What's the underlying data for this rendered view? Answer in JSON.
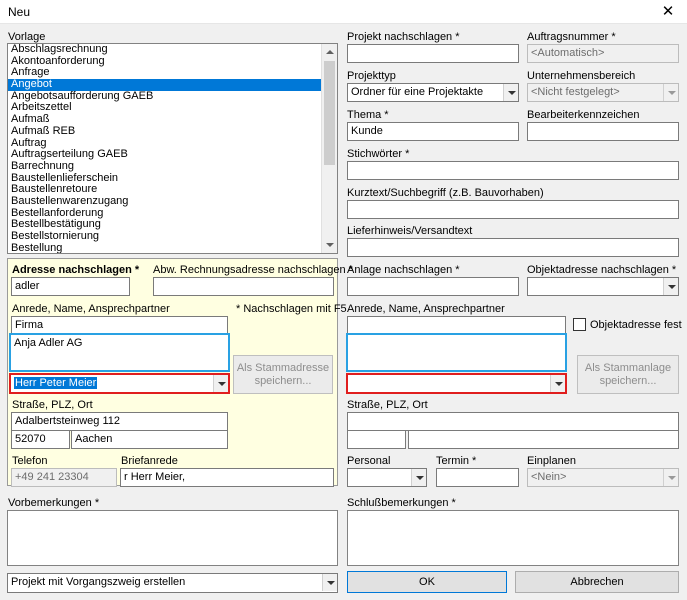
{
  "window": {
    "title": "Neu",
    "close": "✕"
  },
  "vorlage": {
    "label": "Vorlage",
    "selected_index": 3,
    "items": [
      "Abschlagsrechnung",
      "Akontoanforderung",
      "Anfrage",
      "Angebot",
      "Angebotsaufforderung GAEB",
      "Arbeitszettel",
      "Aufmaß",
      "Aufmaß REB",
      "Auftrag",
      "Auftragserteilung GAEB",
      "Barrechnung",
      "Baustellenlieferschein",
      "Baustellenretoure",
      "Baustellenwarenzugang",
      "Bestellanforderung",
      "Bestellbestätigung",
      "Bestellstornierung",
      "Bestellung"
    ]
  },
  "adresse": {
    "nachschlagen_label": "Adresse nachschlagen *",
    "nachschlagen_value": "adler",
    "abw_label": "Abw. Rechnungsadresse nachschlagen *",
    "abw_value": "",
    "anrede_label": "Anrede, Name, Ansprechpartner",
    "f5_hint": "* Nachschlagen mit F5",
    "anrede_value": "Firma",
    "name_value": "Anja Adler AG",
    "ansprechpartner": "Herr Peter Meier",
    "stamm_button": "Als Stammadresse speichern...",
    "strasse_label": "Straße, PLZ, Ort",
    "strasse_value": "Adalbertsteinweg 112",
    "plz_value": "52070",
    "ort_value": "Aachen",
    "telefon_label": "Telefon",
    "telefon_value": "+49 241 23304",
    "briefanrede_label": "Briefanrede",
    "briefanrede_value": "r Herr Meier,"
  },
  "projekt": {
    "nachschlagen_label": "Projekt nachschlagen *",
    "nachschlagen_value": "",
    "auftragsnummer_label": "Auftragsnummer *",
    "auftragsnummer_value": "<Automatisch>",
    "projekttyp_label": "Projekttyp",
    "projekttyp_value": "Ordner für eine Projektakte",
    "unternehmensbereich_label": "Unternehmensbereich",
    "unternehmensbereich_value": "<Nicht festgelegt>",
    "thema_label": "Thema *",
    "thema_value": "Kunde",
    "bearbeiter_label": "Bearbeiterkennzeichen",
    "bearbeiter_value": "",
    "stichwoerter_label": "Stichwörter *",
    "kurztext_label": "Kurztext/Suchbegriff (z.B. Bauvorhaben)",
    "lieferhinweis_label": "Lieferhinweis/Versandtext"
  },
  "anlage": {
    "nachschlagen_label": "Anlage nachschlagen *",
    "objektadresse_label": "Objektadresse nachschlagen *",
    "anrede_label": "Anrede, Name, Ansprechpartner",
    "objektadresse_fest": "Objektadresse fest",
    "stamm_button": "Als Stammanlage speichern...",
    "strasse_label": "Straße, PLZ, Ort"
  },
  "unten": {
    "personal_label": "Personal",
    "termin_label": "Termin *",
    "einplanen_label": "Einplanen",
    "einplanen_value": "<Nein>",
    "vorbemerkungen_label": "Vorbemerkungen *",
    "schluss_label": "Schlußbemerkungen *",
    "vorgang_value": "Projekt mit Vorgangszweig erstellen",
    "ok": "OK",
    "abbrechen": "Abbrechen"
  }
}
